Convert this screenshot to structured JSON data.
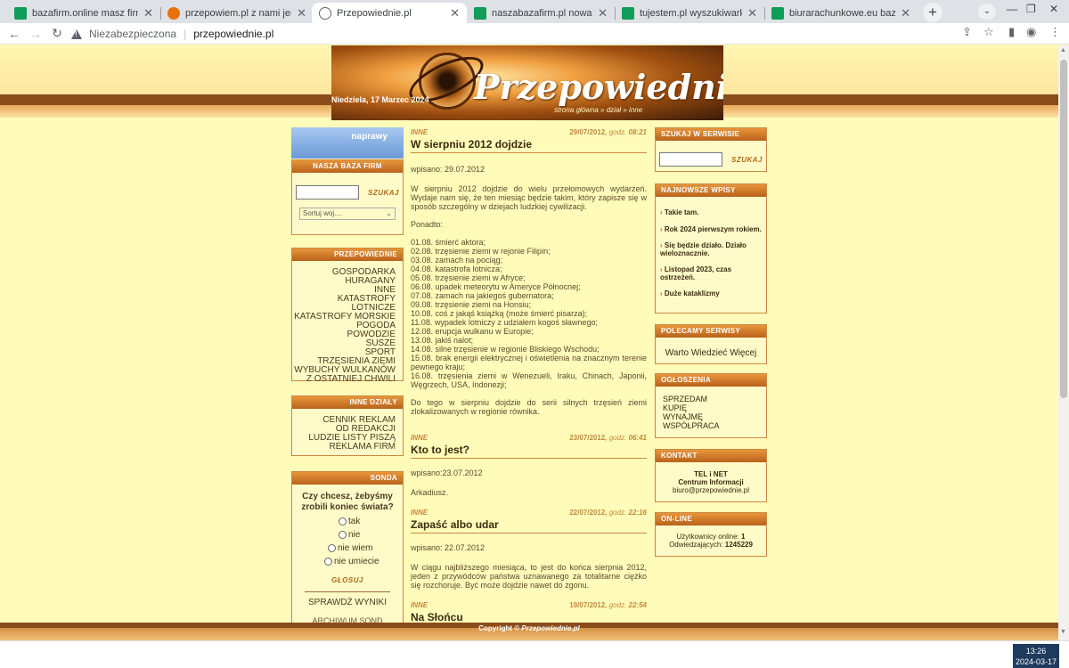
{
  "browser": {
    "tabs": [
      {
        "title": "bazafirm.online masz firmę kup w",
        "icon": "green-square-icon"
      },
      {
        "title": "przepowiem.pl z nami jesteś zna",
        "icon": "orange-flame-icon"
      },
      {
        "title": "Przepowiednie.pl",
        "icon": "globe-icon"
      },
      {
        "title": "naszabazafirm.pl nowa wyszukiw",
        "icon": "green-square-icon"
      },
      {
        "title": "tujestem.pl wyszukiwarka naj",
        "icon": "green-square-icon"
      },
      {
        "title": "biurarachunkowe.eu baza firm ks",
        "icon": "green-square-icon"
      }
    ],
    "security_label": "Niezabezpieczona",
    "url": "przepowiednie.pl"
  },
  "header": {
    "date": "Niedziela, 17 Marzec 2024",
    "site_title": "Przepowiednie",
    "nav": "strona główna » dział » inne"
  },
  "left": {
    "naprawy": "naprawy",
    "baza_title": "NASZA BAZA FIRM",
    "search_button": "SZUKAJ",
    "sort_placeholder": "Sortuj woj....",
    "przepowiednie_title": "PRZEPOWIEDNIE",
    "przepowiednie_items": [
      "GOSPODARKA",
      "HURAGANY",
      "INNE",
      "KATASTROFY LOTNICZE",
      "KATASTROFY MORSKIE",
      "POGODA",
      "POWODZIE",
      "SUSZE",
      "SPORT",
      "TRZĘSIENIA ZIEMI",
      "WYBUCHY WULKANÓW",
      "Z OSTATNIEJ CHWILI"
    ],
    "inne_title": "INNE DZIAŁY",
    "inne_items": [
      "CENNIK REKLAM",
      "OD REDAKCJI",
      "LUDZIE LISTY PISZĄ",
      "REKLAMA FIRM"
    ],
    "sonda_title": "SONDA",
    "sonda_question": "Czy chcesz, żebyśmy zrobili koniec świata?",
    "sonda_options": [
      "tak",
      "nie",
      "nie wiem",
      "nie umiecie"
    ],
    "glosuj": "GŁOSUJ",
    "sprawdz": "SPRAWDŹ WYNIKI",
    "archiwum": "ARCHIWUM SOND"
  },
  "articles": [
    {
      "category": "INNE",
      "date": "29/07/2012",
      "godz": "godz.",
      "time": "08:21",
      "title": "W sierpniu 2012 dojdzie",
      "lines": [
        "wpisano: 29.07.2012",
        "W sierpniu 2012 dojdzie do wielu przełomowych wydarzeń. Wydaje nam się, że ten miesiąc będzie takim, który zapisze się w sposób szczególny w dziejach ludzkiej cywilizacji.",
        "Ponadto:",
        "01.08. śmierć aktora;\n02.08. trzęsienie ziemi w rejonie Filipin;\n03.08. zamach na pociąg;\n04.08. katastrofa lotnicza;\n05.08. trzęsienie ziemi w Afryce;\n06.08. upadek meteorytu w Ameryce Północnej;\n07.08. zamach na jakiegoś gubernatora;\n09.08. trzęsienie ziemi na Honsiu;\n10.08. coś z jakąś książką (może śmierć pisarza);\n11.08. wypadek lotniczy z udziałem kogoś sławnego;\n12.08. erupcja wulkanu w Europie;\n13.08. jakiś nalot;\n14.08. silne trzęsienie w regionie Bliskiego Wschodu;\n15.08. brak energii elektrycznej i oświetlenia na znacznym terenie pewnego kraju;\n16.08. trzęsienia ziemi w Wenezueli, Iraku, Chinach, Japonii, Węgrzech, USA, Indonezji;",
        "Do tego w sierpniu dojdzie do serii silnych trzęsień ziemi zlokalizowanych w regionie równika."
      ]
    },
    {
      "category": "INNE",
      "date": "23/07/2012",
      "godz": "godz.",
      "time": "06:41",
      "title": "Kto to jest?",
      "lines": [
        "wpisano:23.07.2012",
        "Arkadiusz."
      ]
    },
    {
      "category": "INNE",
      "date": "22/07/2012",
      "godz": "godz.",
      "time": "22:16",
      "title": "Zapaść albo udar",
      "lines": [
        "wpisano: 22.07.2012",
        "W ciągu najbliższego miesiąca, to jest do końca sierpnia 2012, jeden z przywódców państwa uznawanego za totalitarne ciężko się rozchoruje. Być może dojdzie nawet do zgonu."
      ]
    },
    {
      "category": "INNE",
      "date": "19/07/2012",
      "godz": "godz.",
      "time": "22:54",
      "title": "Na Słońcu",
      "lines": []
    }
  ],
  "right": {
    "szukaj_title": "SZUKAJ W SERWISIE",
    "search_button": "SZUKAJ",
    "news_title": "NAJNOWSZE WPISY",
    "news_items": [
      "Takie tam.",
      "Rok 2024 pierwszym rokiem.",
      "Się będzie działo. Działo wieloznacznie.",
      "Listopad 2023, czas ostrzeżeń.",
      "Duże kataklizmy"
    ],
    "polecamy_title": "POLECAMY SERWISY",
    "polecamy_link": "Warto Wiedzieć Więcej",
    "ogloszenia_title": "OGŁOSZENIA",
    "ogloszenia_items": [
      "SPRZEDAM",
      "KUPIĘ",
      "WYNAJMĘ",
      "WSPÓŁPRACA"
    ],
    "kontakt_title": "KONTAKT",
    "kontakt_line1": "TEL i NET",
    "kontakt_line2": "Centrum Informacji",
    "kontakt_email": "biuro@przepowiednie.pl",
    "online_title": "ON-LINE",
    "online_users_label": "Użytkownicy online:",
    "online_users": "1",
    "online_visits_label": "Odwiedzających:",
    "online_visits": "1245229"
  },
  "footer": {
    "copyright": "Copyright ©",
    "site": "Przepowiednie.pl"
  },
  "taskbar": {
    "time": "13:26",
    "date": "2024-03-17"
  }
}
